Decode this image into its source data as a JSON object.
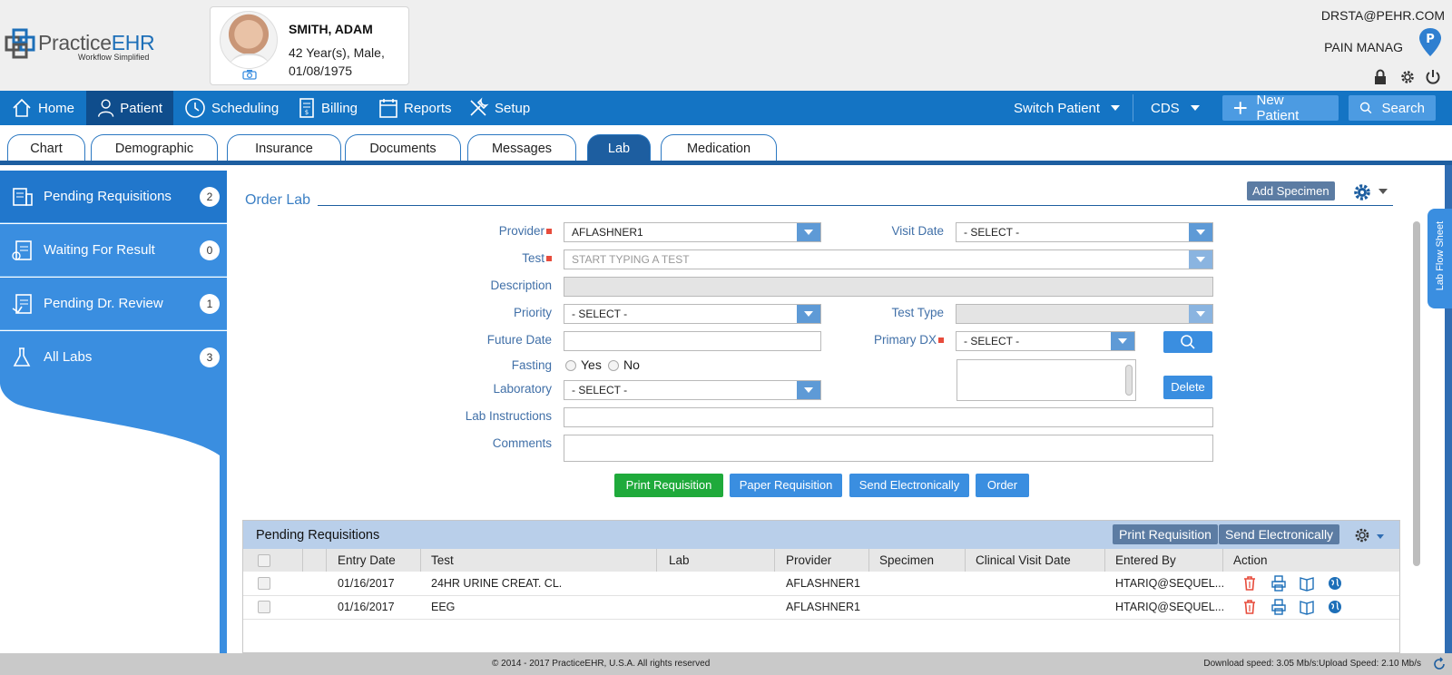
{
  "header": {
    "logo_main": "Practice",
    "logo_accent": "EHR",
    "logo_tagline": "Workflow Simplified",
    "patient_name": "SMITH, ADAM",
    "patient_age_gender": "42 Year(s), Male,",
    "patient_dob": "01/08/1975",
    "user_email": "DRSTA@PEHR.COM",
    "facility": "PAIN MANAG",
    "facility_pin_letter": "P"
  },
  "nav": {
    "items": [
      {
        "label": "Home",
        "icon": "home-icon"
      },
      {
        "label": "Patient",
        "icon": "person-icon"
      },
      {
        "label": "Scheduling",
        "icon": "clock-icon"
      },
      {
        "label": "Billing",
        "icon": "billing-icon"
      },
      {
        "label": "Reports",
        "icon": "calendar-icon"
      },
      {
        "label": "Setup",
        "icon": "tools-icon"
      }
    ],
    "switch_patient": "Switch Patient",
    "cds": "CDS",
    "new_patient": "New Patient",
    "search": "Search"
  },
  "tabs": [
    "Chart",
    "Demographic",
    "Insurance",
    "Documents",
    "Messages",
    "Lab",
    "Medication"
  ],
  "sidebar": {
    "items": [
      {
        "label": "Pending Requisitions",
        "count": "2"
      },
      {
        "label": "Waiting For Result",
        "count": "0"
      },
      {
        "label": "Pending Dr. Review",
        "count": "1"
      },
      {
        "label": "All Labs",
        "count": "3"
      }
    ]
  },
  "order": {
    "title": "Order Lab",
    "add_specimen": "Add Specimen",
    "provider_label": "Provider",
    "provider_value": "AFLASHNER1",
    "visit_date_label": "Visit Date",
    "visit_date_value": "- SELECT -",
    "test_label": "Test",
    "test_placeholder": "START TYPING A TEST",
    "description_label": "Description",
    "priority_label": "Priority",
    "priority_value": "- SELECT -",
    "test_type_label": "Test Type",
    "future_date_label": "Future Date",
    "primary_dx_label": "Primary DX",
    "primary_dx_value": "- SELECT -",
    "fasting_label": "Fasting",
    "fasting_yes": "Yes",
    "fasting_no": "No",
    "laboratory_label": "Laboratory",
    "laboratory_value": "- SELECT -",
    "delete": "Delete",
    "lab_instructions_label": "Lab Instructions",
    "comments_label": "Comments",
    "buttons": {
      "print_requisition": "Print Requisition",
      "paper_requisition": "Paper Requisition",
      "send_electronically": "Send Electronically",
      "order": "Order"
    }
  },
  "pending": {
    "title": "Pending Requisitions",
    "print_requisition": "Print Requisition",
    "send_electronically": "Send Electronically",
    "columns": [
      "Entry Date",
      "Test",
      "Lab",
      "Provider",
      "Specimen",
      "Clinical Visit Date",
      "Entered By",
      "Action"
    ],
    "rows": [
      {
        "entry_date": "01/16/2017",
        "test": "24HR URINE CREAT. CL.",
        "lab": "",
        "provider": "AFLASHNER1",
        "specimen": "",
        "clinical_visit_date": "",
        "entered_by": "HTARIQ@SEQUEL..."
      },
      {
        "entry_date": "01/16/2017",
        "test": "EEG",
        "lab": "",
        "provider": "AFLASHNER1",
        "specimen": "",
        "clinical_visit_date": "",
        "entered_by": "HTARIQ@SEQUEL..."
      }
    ]
  },
  "lab_flow_sheet": "Lab Flow Sheet",
  "footer": {
    "copyright": "© 2014 - 2017 PracticeEHR, U.S.A. All rights reserved",
    "speed": "Download speed: 3.05 Mb/s:Upload Speed: 2.10 Mb/s"
  },
  "colors": {
    "nav_bg": "#1474c4",
    "nav_active": "#0f4d8c",
    "tab_active": "#1d5ea0",
    "sidebar_bg": "#3a8ee0",
    "print_btn_green": "#1faa3b",
    "label_blue": "#4170a8",
    "required_red": "#e74c3c"
  }
}
